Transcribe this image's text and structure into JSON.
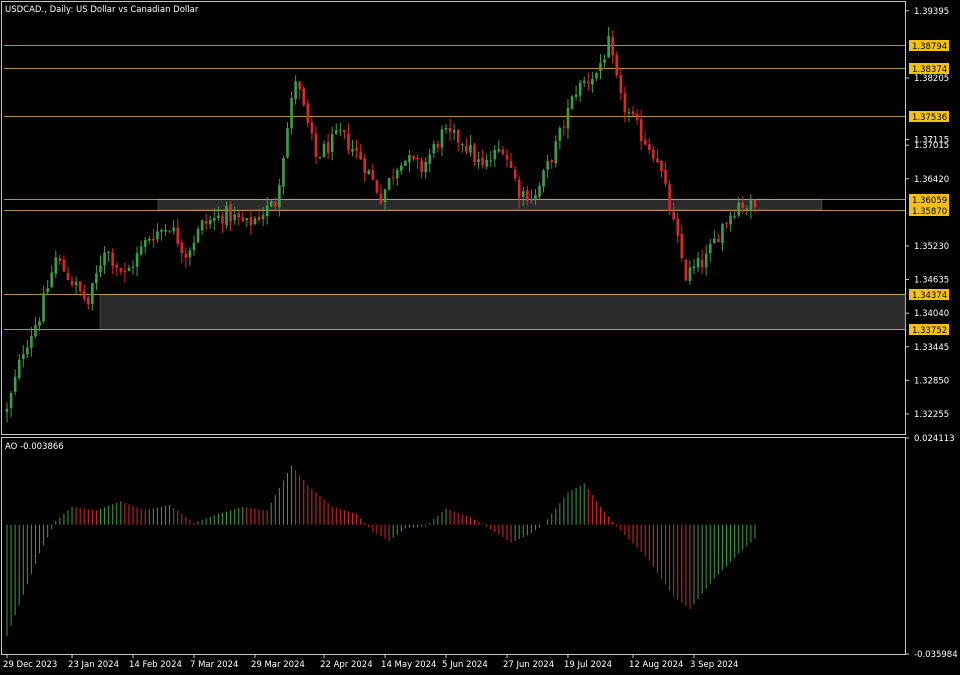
{
  "chart_data": {
    "type": "candlestick",
    "title": "USDCAD., Daily:  US Dollar vs Canadian Dollar",
    "symbol": "USDCAD.",
    "timeframe": "Daily",
    "description": "US Dollar vs Canadian Dollar",
    "price_axis": {
      "ylim": [
        1.319,
        1.3955
      ],
      "ticks": [
        "1.39395",
        "1.38205",
        "1.37115",
        "1.37015",
        "1.36420",
        "1.35230",
        "1.34635",
        "1.34040",
        "1.33445",
        "1.32850",
        "1.32255"
      ]
    },
    "horizontal_levels": [
      "1.38794",
      "1.38374",
      "1.37536",
      "1.36059",
      "1.35870",
      "1.34374",
      "1.33752"
    ],
    "zones": [
      {
        "from": 1.3587,
        "to": 1.36059
      },
      {
        "from": 1.33752,
        "to": 1.34374
      }
    ],
    "date_labels": [
      "29 Dec 2023",
      "23 Jan 2024",
      "14 Feb 2024",
      "7 Mar 2024",
      "29 Mar 2024",
      "22 Apr 2024",
      "14 May 2024",
      "5 Jun 2024",
      "27 Jun 2024",
      "19 Jul 2024",
      "12 Aug 2024",
      "3 Sep 2024"
    ],
    "date_label_bars": [
      0,
      16,
      31,
      46,
      61,
      78,
      93,
      108,
      123,
      138,
      154,
      169
    ],
    "price_waypoints": [
      {
        "bar": 0,
        "close": 1.323
      },
      {
        "bar": 4,
        "close": 1.334
      },
      {
        "bar": 8,
        "close": 1.34
      },
      {
        "bar": 12,
        "close": 1.35
      },
      {
        "bar": 16,
        "close": 1.346
      },
      {
        "bar": 20,
        "close": 1.342
      },
      {
        "bar": 24,
        "close": 1.352
      },
      {
        "bar": 29,
        "close": 1.347
      },
      {
        "bar": 35,
        "close": 1.354
      },
      {
        "bar": 40,
        "close": 1.356
      },
      {
        "bar": 44,
        "close": 1.351
      },
      {
        "bar": 48,
        "close": 1.356
      },
      {
        "bar": 54,
        "close": 1.358
      },
      {
        "bar": 59,
        "close": 1.356
      },
      {
        "bar": 66,
        "close": 1.36
      },
      {
        "bar": 71,
        "close": 1.382
      },
      {
        "bar": 76,
        "close": 1.368
      },
      {
        "bar": 82,
        "close": 1.372
      },
      {
        "bar": 87,
        "close": 1.368
      },
      {
        "bar": 92,
        "close": 1.361
      },
      {
        "bar": 97,
        "close": 1.368
      },
      {
        "bar": 102,
        "close": 1.366
      },
      {
        "bar": 107,
        "close": 1.372
      },
      {
        "bar": 112,
        "close": 1.371
      },
      {
        "bar": 117,
        "close": 1.366
      },
      {
        "bar": 122,
        "close": 1.37
      },
      {
        "bar": 126,
        "close": 1.362
      },
      {
        "bar": 130,
        "close": 1.361
      },
      {
        "bar": 135,
        "close": 1.37
      },
      {
        "bar": 140,
        "close": 1.38
      },
      {
        "bar": 145,
        "close": 1.383
      },
      {
        "bar": 148,
        "close": 1.388
      },
      {
        "bar": 151,
        "close": 1.378
      },
      {
        "bar": 156,
        "close": 1.372
      },
      {
        "bar": 160,
        "close": 1.368
      },
      {
        "bar": 163,
        "close": 1.359
      },
      {
        "bar": 167,
        "close": 1.347
      },
      {
        "bar": 172,
        "close": 1.35
      },
      {
        "bar": 176,
        "close": 1.356
      },
      {
        "bar": 180,
        "close": 1.36
      },
      {
        "bar": 184,
        "close": 1.359
      }
    ],
    "bar_count": 185,
    "oscillator": {
      "name": "AO",
      "value": "-0.003866",
      "ylim": [
        -0.035984,
        0.024113
      ],
      "ticks": [
        "0.024113",
        "-0.035984"
      ],
      "waypoints": [
        {
          "bar": 0,
          "value": -0.031
        },
        {
          "bar": 8,
          "value": -0.008
        },
        {
          "bar": 12,
          "value": 0.001
        },
        {
          "bar": 16,
          "value": 0.005
        },
        {
          "bar": 22,
          "value": 0.004
        },
        {
          "bar": 28,
          "value": 0.0065
        },
        {
          "bar": 34,
          "value": 0.004
        },
        {
          "bar": 40,
          "value": 0.0055
        },
        {
          "bar": 46,
          "value": 0.0005
        },
        {
          "bar": 52,
          "value": 0.003
        },
        {
          "bar": 58,
          "value": 0.005
        },
        {
          "bar": 64,
          "value": 0.004
        },
        {
          "bar": 70,
          "value": 0.0165
        },
        {
          "bar": 74,
          "value": 0.011
        },
        {
          "bar": 80,
          "value": 0.005
        },
        {
          "bar": 86,
          "value": 0.003
        },
        {
          "bar": 90,
          "value": -0.002
        },
        {
          "bar": 94,
          "value": -0.0045
        },
        {
          "bar": 98,
          "value": -0.001
        },
        {
          "bar": 103,
          "value": -0.0005
        },
        {
          "bar": 108,
          "value": 0.0045
        },
        {
          "bar": 114,
          "value": 0.002
        },
        {
          "bar": 118,
          "value": -0.0005
        },
        {
          "bar": 124,
          "value": -0.005
        },
        {
          "bar": 128,
          "value": -0.003
        },
        {
          "bar": 132,
          "value": 0.0
        },
        {
          "bar": 138,
          "value": 0.009
        },
        {
          "bar": 142,
          "value": 0.0115
        },
        {
          "bar": 146,
          "value": 0.005
        },
        {
          "bar": 150,
          "value": -0.0005
        },
        {
          "bar": 158,
          "value": -0.01
        },
        {
          "bar": 164,
          "value": -0.02
        },
        {
          "bar": 168,
          "value": -0.0235
        },
        {
          "bar": 174,
          "value": -0.015
        },
        {
          "bar": 180,
          "value": -0.008
        },
        {
          "bar": 184,
          "value": -0.0039
        }
      ]
    },
    "colors": {
      "background": "#000000",
      "bull": "#3c9e47",
      "bear": "#d9272e",
      "level_line": "#e3c84a",
      "level_tag_fill": "#f4c20d",
      "zone_fill": "#2b2b2b",
      "axis": "#c8c8c8",
      "text": "#ffffff"
    },
    "grid": false
  }
}
